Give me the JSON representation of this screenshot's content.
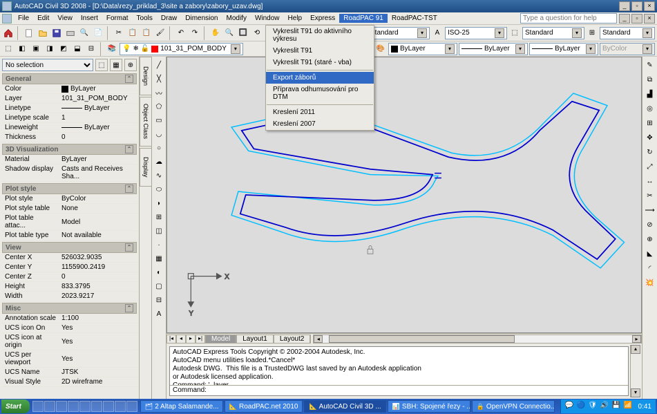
{
  "title": "AutoCAD Civil 3D 2008 - [D:\\Data\\rezy_priklad_3\\site a zabory\\zabory_uzav.dwg]",
  "menu": {
    "file": "File",
    "edit": "Edit",
    "view": "View",
    "insert": "Insert",
    "format": "Format",
    "tools": "Tools",
    "draw": "Draw",
    "dimension": "Dimension",
    "modify": "Modify",
    "window": "Window",
    "help": "Help",
    "express": "Express",
    "roadpac91": "RoadPAC 91",
    "roadpactst": "RoadPAC-TST"
  },
  "help_placeholder": "Type a question for help",
  "tb": {
    "std": "Standard",
    "iso": "ISO-25",
    "bylayer": "ByLayer",
    "bycolor": "ByColor",
    "layer": "101_31_POM_BODY"
  },
  "dropdown": {
    "i1": "Vykreslit T91 do aktivního výkresu",
    "i2": "Vykreslit T91",
    "i3": "Vykreslit T91 (staré - vba)",
    "i4": "Export záborů",
    "i5": "Příprava odhumusování pro DTM",
    "i6": "Kreslení 2011",
    "i7": "Kreslení 2007"
  },
  "sidetabs": {
    "design": "Design",
    "objclass": "Object Class",
    "display": "Display"
  },
  "props": {
    "nosel": "No selection",
    "g_general": "General",
    "color_l": "Color",
    "color_v": "ByLayer",
    "layer_l": "Layer",
    "layer_v": "101_31_POM_BODY",
    "ltype_l": "Linetype",
    "ltype_v": "ByLayer",
    "ltscale_l": "Linetype scale",
    "ltscale_v": "1",
    "lweight_l": "Lineweight",
    "lweight_v": "ByLayer",
    "thick_l": "Thickness",
    "thick_v": "0",
    "g_3d": "3D Visualization",
    "mat_l": "Material",
    "mat_v": "ByLayer",
    "shadow_l": "Shadow display",
    "shadow_v": "Casts and Receives Sha...",
    "g_plot": "Plot style",
    "pstyle_l": "Plot style",
    "pstyle_v": "ByColor",
    "pstab_l": "Plot style table",
    "pstab_v": "None",
    "ptatt_l": "Plot table attac...",
    "ptatt_v": "Model",
    "pttype_l": "Plot table type",
    "pttype_v": "Not available",
    "g_view": "View",
    "cx_l": "Center X",
    "cx_v": "526032.9035",
    "cy_l": "Center Y",
    "cy_v": "1155900.2419",
    "cz_l": "Center Z",
    "cz_v": "0",
    "h_l": "Height",
    "h_v": "833.3795",
    "w_l": "Width",
    "w_v": "2023.9217",
    "g_misc": "Misc",
    "ann_l": "Annotation scale",
    "ann_v": "1:100",
    "ucsico_l": "UCS icon On",
    "ucsico_v": "Yes",
    "ucsorig_l": "UCS icon at origin",
    "ucsorig_v": "Yes",
    "ucsvp_l": "UCS per viewport",
    "ucsvp_v": "Yes",
    "ucsname_l": "UCS Name",
    "ucsname_v": "JTSK",
    "vstyle_l": "Visual Style",
    "vstyle_v": "2D wireframe"
  },
  "axes": {
    "x": "X",
    "y": "Y"
  },
  "tabs": {
    "model": "Model",
    "l1": "Layout1",
    "l2": "Layout2"
  },
  "cmd": {
    "l1": "AutoCAD Express Tools Copyright © 2002-2004 Autodesk, Inc.",
    "l2": "AutoCAD menu utilities loaded.*Cancel*",
    "l3": "Autodesk DWG.  This file is a TrustedDWG last saved by an Autodesk application",
    "l4": "or Autodesk licensed application.",
    "l5": "Command: '_layer",
    "prompt": "Command:"
  },
  "taskbar": {
    "start": "Start",
    "t1": "2 Altap Salamande...",
    "t2": "RoadPAC.net 2010",
    "t3": "AutoCAD Civil 3D ...",
    "t4": "SBH: Spojené řezy - ...",
    "t5": "OpenVPN Connectio...",
    "clock": "0:41"
  }
}
